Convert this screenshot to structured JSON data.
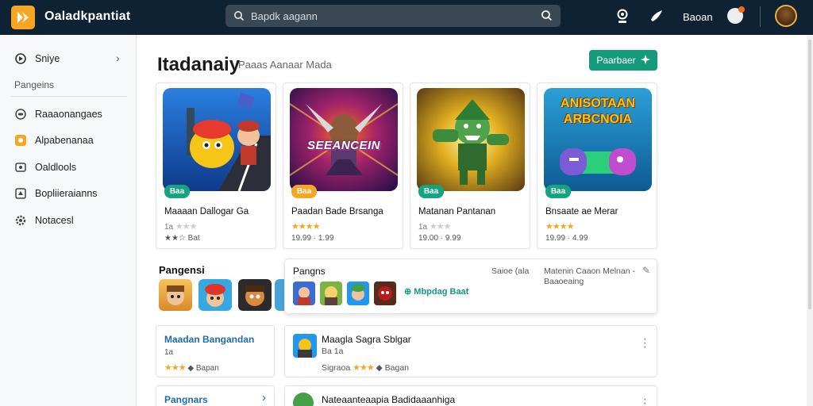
{
  "app": {
    "title": "Oaladkpantiat"
  },
  "search": {
    "text": "Bapdk aagann"
  },
  "header": {
    "user_label": "Baoan"
  },
  "sidebar": {
    "top_item": "Sniye",
    "section": "Pangeins",
    "items": [
      {
        "label": "Raaaonangaes",
        "icon": "gamepad-icon"
      },
      {
        "label": "Alpabenanaa",
        "icon": "star-icon"
      },
      {
        "label": "Oaldlools",
        "icon": "folder-icon"
      },
      {
        "label": "Bopliieraianns",
        "icon": "trophy-icon"
      },
      {
        "label": "Notacesl",
        "icon": "gear-icon"
      }
    ]
  },
  "main": {
    "title": "Itadanaiy",
    "subtitle": "Paaas Aanaar Mada",
    "primary_button": "Paarbaer",
    "cards": [
      {
        "badge": "Baa",
        "badge_color": "#16a37f",
        "title": "Maaaan Dallogar Ga",
        "meta": "1a",
        "rating": "★★☆ Bat",
        "stars": 2
      },
      {
        "badge": "Baa",
        "badge_color": "#f5a623",
        "title": "Paadan Bade Brsanga",
        "meta": "★★★★",
        "rating": "19.99 · 1.99",
        "stars": 4,
        "art_text": "SEEANCEIN"
      },
      {
        "badge": "Baa",
        "badge_color": "#16a37f",
        "title": "Matanan Pantanan",
        "meta": "1a",
        "rating": "19.00 · 9.99",
        "stars": 3
      },
      {
        "badge": "Baa",
        "badge_color": "#16a37f",
        "title": "Bnsaate ae Merar",
        "meta": "★★★★",
        "rating": "19.99 · 4.99",
        "stars": 4,
        "art_text_1": "ANISOTAAN",
        "art_text_2": "ARBCNOIA"
      }
    ],
    "section_left": "Pangensi",
    "popover": {
      "title": "Pangns",
      "mid": "Saioe (ala",
      "right": "Matenin Caaon Melnan - Baaoeaing",
      "link": "Mbpdag Baat"
    },
    "panel_left": {
      "title": "Maadan Bangandan",
      "meta": "1a",
      "rating_text": "Bapan"
    },
    "panel_right": {
      "title": "Maagla Sagra Sblgar",
      "meta": "Ba 1a",
      "rating_text": "Bagan",
      "rating_prefix": "Sigraoa"
    },
    "panel_left_2": {
      "title": "Pangnars"
    },
    "panel_right_2": {
      "title": "Nateaanteaapia Badidaaanhiga"
    }
  },
  "colors": {
    "accent": "#159b7c",
    "topbar": "#0f2233",
    "star": "#f5a623"
  }
}
